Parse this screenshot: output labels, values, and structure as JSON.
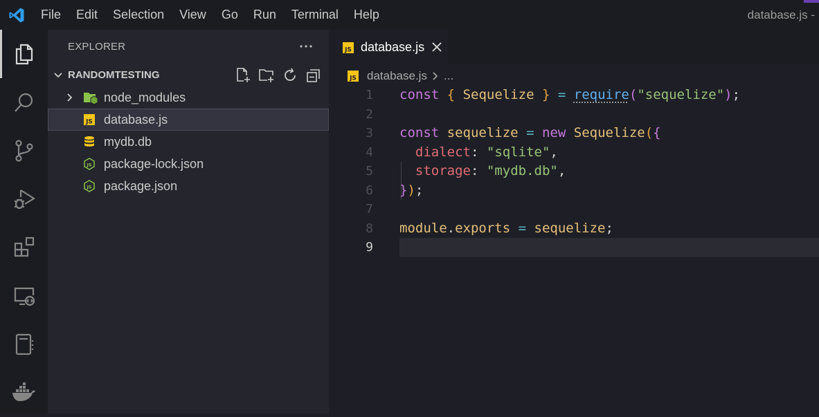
{
  "window": {
    "title": "database.js -"
  },
  "menu": [
    "File",
    "Edit",
    "Selection",
    "View",
    "Go",
    "Run",
    "Terminal",
    "Help"
  ],
  "activity_bar": [
    "explorer-icon",
    "search-icon",
    "source-control-icon",
    "run-debug-icon",
    "extensions-icon",
    "remote-explorer-icon",
    "notebook-icon",
    "docker-icon"
  ],
  "sidebar": {
    "header": "EXPLORER",
    "more_label": "···",
    "section_title": "RANDOMTESTING",
    "items": [
      {
        "label": "node_modules",
        "icon": "folder-node-icon"
      },
      {
        "label": "database.js",
        "icon": "js-file-icon"
      },
      {
        "label": "mydb.db",
        "icon": "database-icon"
      },
      {
        "label": "package-lock.json",
        "icon": "node-json-icon"
      },
      {
        "label": "package.json",
        "icon": "node-json-icon"
      }
    ]
  },
  "editor": {
    "tab_label": "database.js",
    "breadcrumb": {
      "file": "database.js",
      "more": "..."
    },
    "line_numbers": [
      "1",
      "2",
      "3",
      "4",
      "5",
      "6",
      "7",
      "8",
      "9"
    ],
    "code": {
      "l1": {
        "kw": "const",
        "ob": "{",
        "name": "Sequelize",
        "cb": "}",
        "eq": "=",
        "fn": "require",
        "po": "(",
        "str": "\"sequelize\"",
        "pc": ")",
        "semi": ";"
      },
      "l3": {
        "kw": "const",
        "name": "sequelize",
        "eq": "=",
        "new": "new",
        "cls": "Sequelize",
        "po": "(",
        "ob": "{"
      },
      "l4": {
        "prop": "dialect",
        "colon": ":",
        "str": "\"sqlite\"",
        "comma": ","
      },
      "l5": {
        "prop": "storage",
        "colon": ":",
        "str": "\"mydb.db\"",
        "comma": ","
      },
      "l6": {
        "cb": "}",
        "pc": ")",
        "semi": ";"
      },
      "l8": {
        "mod": "module",
        "dot": ".",
        "exp": "exports",
        "eq": "=",
        "val": "sequelize",
        "semi": ";"
      }
    }
  },
  "colors": {
    "keyword": "#c679dd",
    "string": "#98c379",
    "property": "#e06c75",
    "class": "#e5c07b",
    "function": "#61afef",
    "accent": "#007acc"
  }
}
